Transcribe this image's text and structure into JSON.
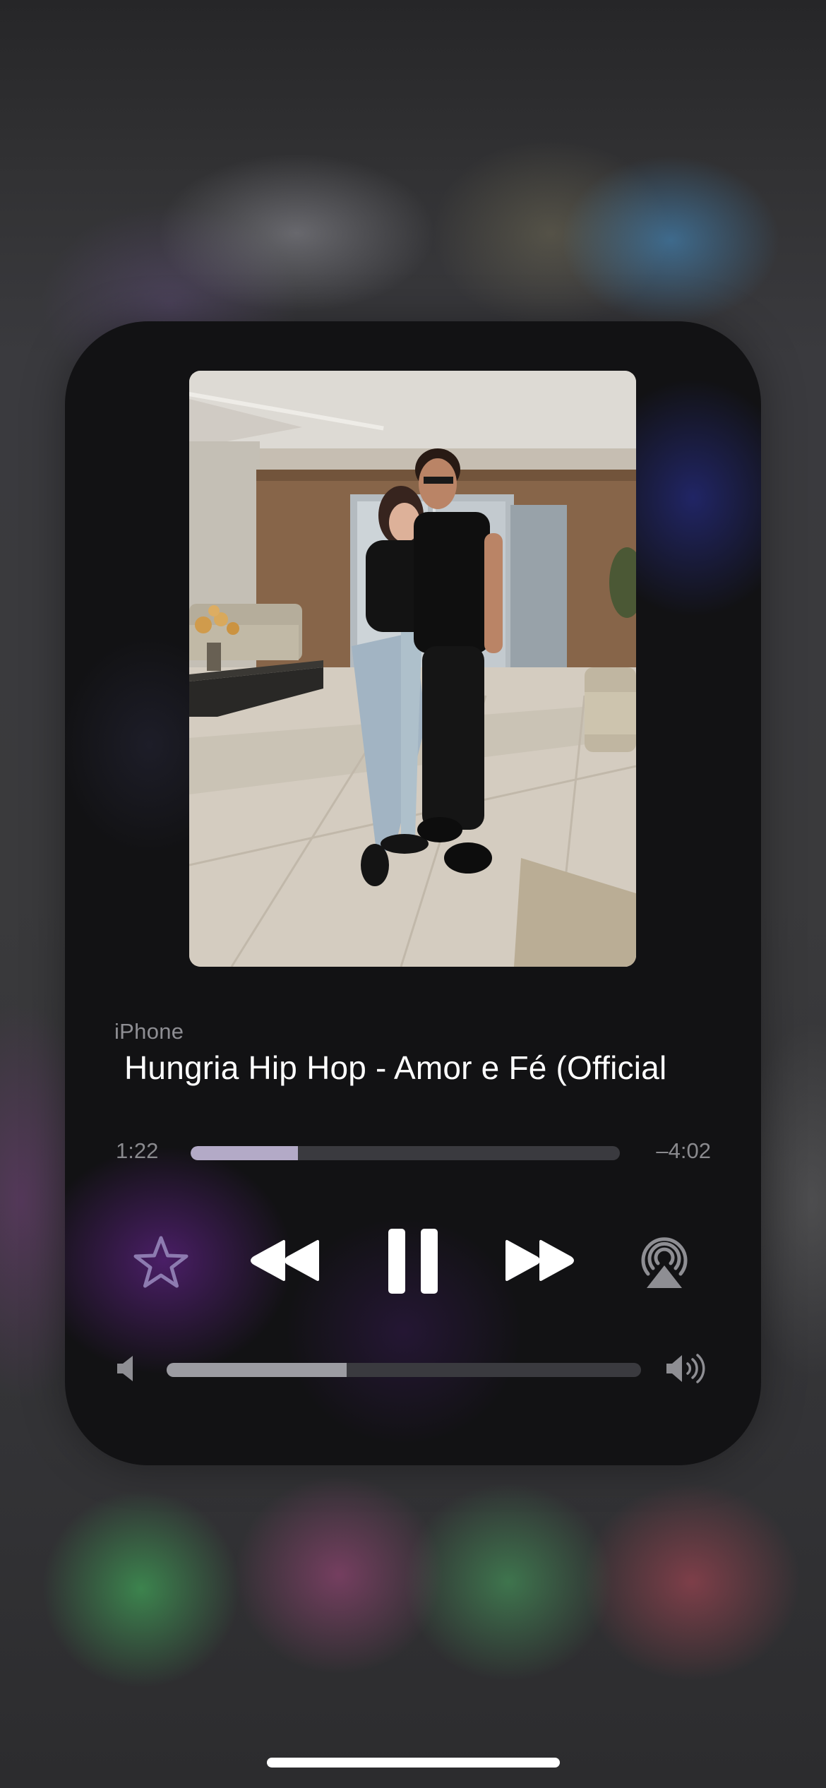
{
  "now_playing": {
    "source": "iPhone",
    "title": "Hungria Hip Hop - Amor e Fé (Official",
    "artwork_icon": "album-artwork-photo"
  },
  "playback": {
    "elapsed": "1:22",
    "remaining": "–4:02",
    "progress_fraction": 0.25,
    "state": "playing"
  },
  "controls": {
    "favorite_icon": "star-icon",
    "previous_icon": "rewind-icon",
    "play_pause_icon": "pause-icon",
    "next_icon": "fast-forward-icon",
    "airplay_icon": "airplay-icon"
  },
  "volume": {
    "level_fraction": 0.38,
    "low_icon": "speaker-low-icon",
    "high_icon": "speaker-high-icon"
  },
  "colors": {
    "progress_fill": "#b3aac7",
    "favorite_accent": "#8d7bb0",
    "card_background": "#121214"
  }
}
